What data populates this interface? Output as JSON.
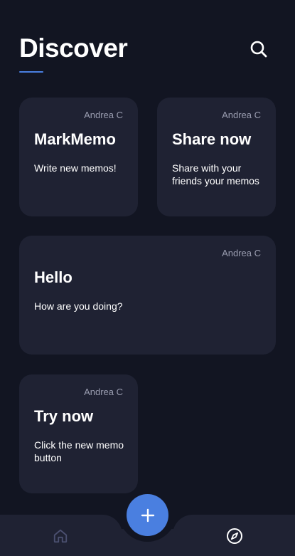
{
  "header": {
    "title": "Discover",
    "accent_color": "#4a7fe0",
    "search_icon": "search-icon"
  },
  "cards": [
    {
      "author": "Andrea C",
      "title": "MarkMemo",
      "body": "Write new memos!"
    },
    {
      "author": "Andrea C",
      "title": "Share now",
      "body": "Share with your friends your memos"
    },
    {
      "author": "Andrea C",
      "title": "Hello",
      "body": "How are you doing?"
    },
    {
      "author": "Andrea C",
      "title": "Try now",
      "body": "Click the new memo button"
    }
  ],
  "bottom_nav": {
    "items": [
      {
        "icon": "home-icon",
        "color": "#4b5070"
      },
      {
        "icon": "compass-icon",
        "color": "#ffffff"
      }
    ],
    "fab_icon": "plus-icon",
    "fab_color": "#4a7fe0"
  },
  "colors": {
    "background": "#121522",
    "card": "#1f2233",
    "muted_text": "#9a9db0"
  }
}
